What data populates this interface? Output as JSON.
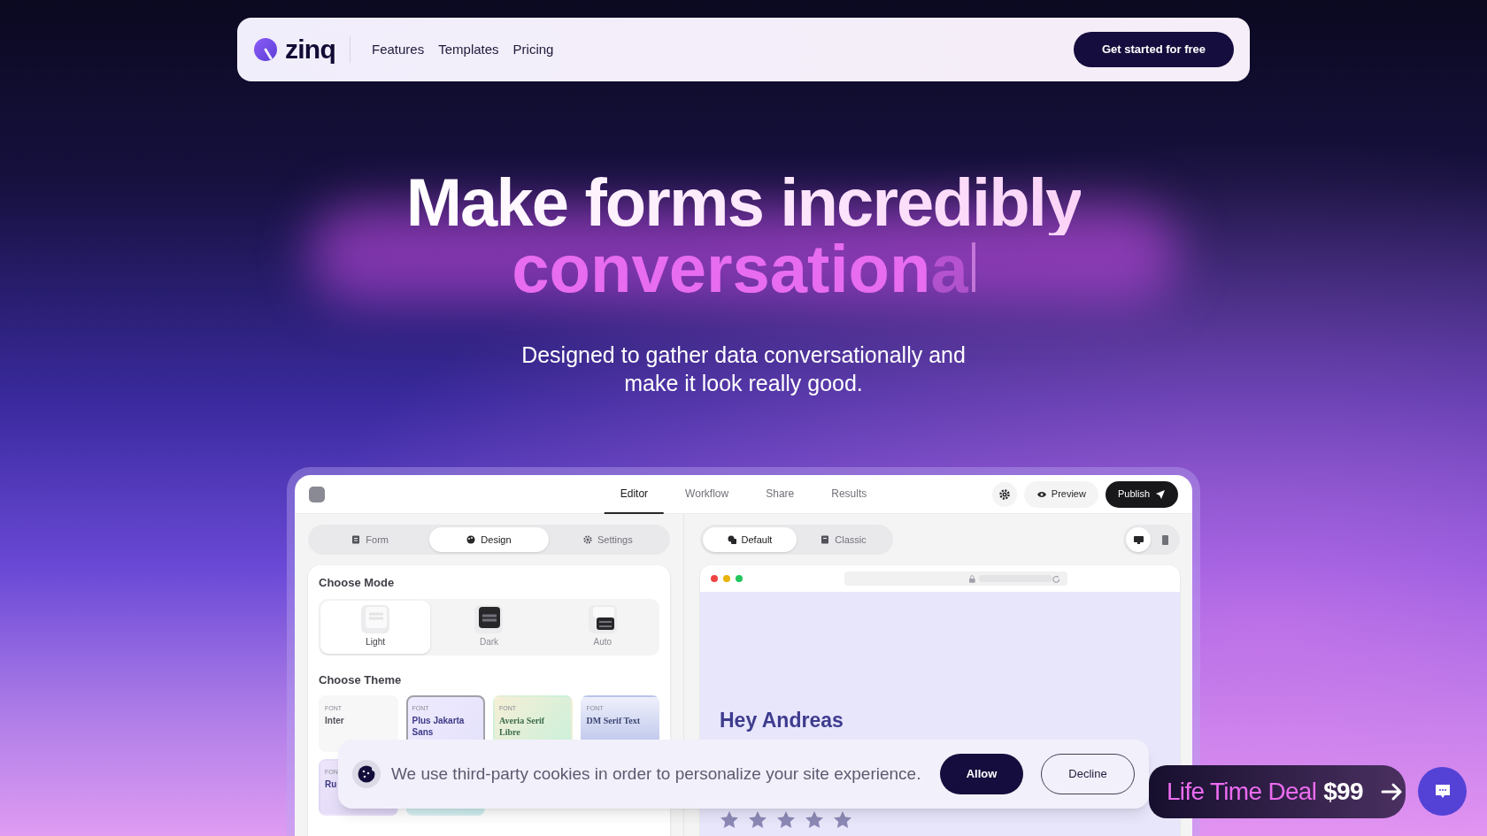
{
  "nav": {
    "brand": "zinq",
    "links": [
      "Features",
      "Templates",
      "Pricing"
    ],
    "cta": "Get started for free"
  },
  "hero": {
    "headline_line_1": "Make forms incredibly",
    "headline_line_2": "conversation",
    "headline_line_2_fading": "a",
    "subtitle": "Designed to gather data conversationally and make it look really good."
  },
  "app": {
    "tabs": [
      {
        "label": "Editor",
        "selected": true
      },
      {
        "label": "Workflow",
        "selected": false
      },
      {
        "label": "Share",
        "selected": false
      },
      {
        "label": "Results",
        "selected": false
      }
    ],
    "preview_button": "Preview",
    "publish_button": "Publish",
    "panel_tabs": [
      {
        "label": "Form",
        "kind": "form",
        "selected": false
      },
      {
        "label": "Design",
        "kind": "design",
        "selected": true
      },
      {
        "label": "Settings",
        "kind": "settings",
        "selected": false
      }
    ],
    "preview_tabs": [
      {
        "label": "Default",
        "kind": "default",
        "selected": true
      },
      {
        "label": "Classic",
        "kind": "classic",
        "selected": false
      }
    ],
    "device_toggles": [
      {
        "kind": "desktop",
        "selected": true
      },
      {
        "kind": "mobile",
        "selected": false
      }
    ],
    "choose_mode": {
      "title": "Choose Mode",
      "modes": [
        {
          "label": "Light",
          "kind": "light",
          "selected": true
        },
        {
          "label": "Dark",
          "kind": "dark",
          "selected": false
        },
        {
          "label": "Auto",
          "kind": "auto",
          "selected": false
        }
      ]
    },
    "choose_theme": {
      "title": "Choose Theme",
      "themes": [
        {
          "caption": "FONT",
          "name": "Inter",
          "kind": "plain",
          "selected": false
        },
        {
          "caption": "FONT",
          "name": "Plus Jakarta Sans",
          "kind": "lavender",
          "selected": true
        },
        {
          "caption": "FONT",
          "name": "Averia Serif Libre",
          "kind": "mint",
          "selected": false
        },
        {
          "caption": "FONT",
          "name": "DM Serif Text",
          "kind": "slate",
          "selected": false
        },
        {
          "caption": "FON",
          "name": "Ru",
          "kind": "lilac",
          "selected": false
        },
        {
          "kind": "teal",
          "selected": false
        }
      ]
    },
    "preview": {
      "greeting": "Hey Andreas",
      "stars": 5
    }
  },
  "cookie_banner": {
    "text": "We use third-party cookies in order to personalize your site experience.",
    "allow": "Allow",
    "decline": "Decline"
  },
  "deal_button": {
    "label": "Life Time Deal",
    "price": "$99"
  }
}
